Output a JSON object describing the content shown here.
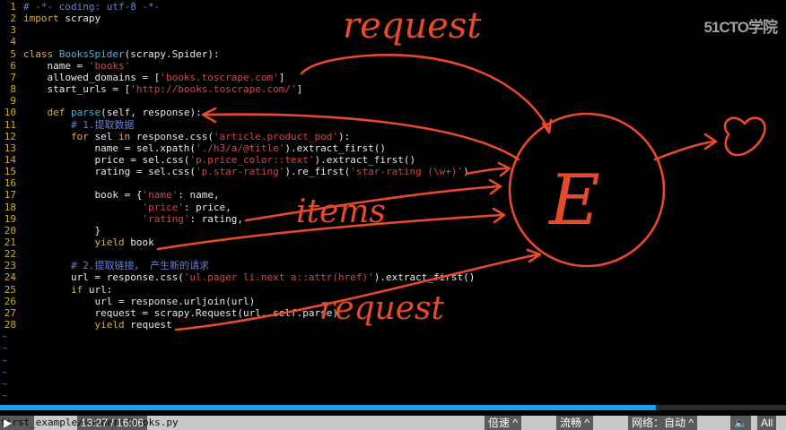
{
  "code_lines": [
    {
      "n": "1",
      "tokens": [
        [
          "c-cm",
          "# -*- coding: utf-8 -*-"
        ]
      ]
    },
    {
      "n": "2",
      "tokens": [
        [
          "c-kw",
          "import"
        ],
        [
          "c-var",
          " scrapy"
        ]
      ]
    },
    {
      "n": "3",
      "tokens": []
    },
    {
      "n": "4",
      "tokens": []
    },
    {
      "n": "5",
      "tokens": [
        [
          "c-kw",
          "class"
        ],
        [
          "c-var",
          " "
        ],
        [
          "c-cls",
          "BooksSpider"
        ],
        [
          "c-var",
          "(scrapy.Spider):"
        ]
      ]
    },
    {
      "n": "6",
      "tokens": [
        [
          "c-var",
          "    name = "
        ],
        [
          "c-str",
          "'books'"
        ]
      ]
    },
    {
      "n": "7",
      "tokens": [
        [
          "c-var",
          "    allowed_domains = ["
        ],
        [
          "c-str",
          "'books.toscrape.com'"
        ],
        [
          "c-var",
          "]"
        ]
      ]
    },
    {
      "n": "8",
      "tokens": [
        [
          "c-var",
          "    start_urls = ["
        ],
        [
          "c-str",
          "'http://books.toscrape.com/'"
        ],
        [
          "c-var",
          "]"
        ]
      ]
    },
    {
      "n": "9",
      "tokens": []
    },
    {
      "n": "10",
      "tokens": [
        [
          "c-var",
          "    "
        ],
        [
          "c-kw",
          "def"
        ],
        [
          "c-var",
          " "
        ],
        [
          "c-cls",
          "parse"
        ],
        [
          "c-var",
          "(self, response):"
        ]
      ]
    },
    {
      "n": "11",
      "tokens": [
        [
          "c-var",
          "        "
        ],
        [
          "c-cm",
          "# 1.提取数据"
        ]
      ]
    },
    {
      "n": "12",
      "tokens": [
        [
          "c-var",
          "        "
        ],
        [
          "c-kw",
          "for"
        ],
        [
          "c-var",
          " sel "
        ],
        [
          "c-kw",
          "in"
        ],
        [
          "c-var",
          " response.css("
        ],
        [
          "c-str",
          "'article.product_pod'"
        ],
        [
          "c-var",
          "):"
        ]
      ]
    },
    {
      "n": "13",
      "tokens": [
        [
          "c-var",
          "            name = sel.xpath("
        ],
        [
          "c-str",
          "'./h3/a/@title'"
        ],
        [
          "c-var",
          ").extract_first()"
        ]
      ]
    },
    {
      "n": "14",
      "tokens": [
        [
          "c-var",
          "            price = sel.css("
        ],
        [
          "c-str",
          "'p.price_color::text'"
        ],
        [
          "c-var",
          ").extract_first()"
        ]
      ]
    },
    {
      "n": "15",
      "tokens": [
        [
          "c-var",
          "            rating = sel.css("
        ],
        [
          "c-str",
          "'p.star-rating'"
        ],
        [
          "c-var",
          ").re_first("
        ],
        [
          "c-str",
          "'star-rating (\\w+)'"
        ],
        [
          "c-var",
          ")"
        ]
      ]
    },
    {
      "n": "16",
      "tokens": []
    },
    {
      "n": "17",
      "tokens": [
        [
          "c-var",
          "            book = {"
        ],
        [
          "c-str",
          "'name'"
        ],
        [
          "c-var",
          ": name,"
        ]
      ]
    },
    {
      "n": "18",
      "tokens": [
        [
          "c-var",
          "                    "
        ],
        [
          "c-str",
          "'price'"
        ],
        [
          "c-var",
          ": price,"
        ]
      ]
    },
    {
      "n": "19",
      "tokens": [
        [
          "c-var",
          "                    "
        ],
        [
          "c-str",
          "'rating'"
        ],
        [
          "c-var",
          ": rating,"
        ]
      ]
    },
    {
      "n": "20",
      "tokens": [
        [
          "c-var",
          "            }"
        ]
      ]
    },
    {
      "n": "21",
      "tokens": [
        [
          "c-var",
          "            "
        ],
        [
          "c-kw",
          "yield"
        ],
        [
          "c-var",
          " book"
        ]
      ]
    },
    {
      "n": "22",
      "tokens": []
    },
    {
      "n": "23",
      "tokens": [
        [
          "c-var",
          "        "
        ],
        [
          "c-cm",
          "# 2.提取链接， 产生新的请求"
        ]
      ]
    },
    {
      "n": "24",
      "tokens": [
        [
          "c-var",
          "        url = response.css("
        ],
        [
          "c-str",
          "'ul.pager li.next a::attr(href)'"
        ],
        [
          "c-var",
          ").extract_first()"
        ]
      ]
    },
    {
      "n": "25",
      "tokens": [
        [
          "c-var",
          "        "
        ],
        [
          "c-kw",
          "if"
        ],
        [
          "c-var",
          " url:"
        ]
      ]
    },
    {
      "n": "26",
      "tokens": [
        [
          "c-var",
          "            url = response.urljoin(url)"
        ]
      ]
    },
    {
      "n": "27",
      "tokens": [
        [
          "c-var",
          "            request = scrapy.Request(url, self.parse)"
        ]
      ]
    },
    {
      "n": "28",
      "tokens": [
        [
          "c-var",
          "            "
        ],
        [
          "c-kw",
          "yield"
        ],
        [
          "c-var",
          " request"
        ]
      ]
    }
  ],
  "empty_marker": "~",
  "annotations": {
    "request_top": "request",
    "items": "items",
    "request_bottom": "request",
    "engine_letter": "E"
  },
  "watermark": "51CTO学院",
  "status_filename": "first_example/spiders/books.py",
  "video": {
    "time_display": "13:27 / 16:06",
    "progress_percent": 83.5,
    "speed_label": "倍速 ^",
    "quality_label": "流畅 ^",
    "network_label": "网络：自动 ^",
    "all_label": "All"
  },
  "colors": {
    "annotation": "#e8492a",
    "progress": "#1aa0e6"
  }
}
